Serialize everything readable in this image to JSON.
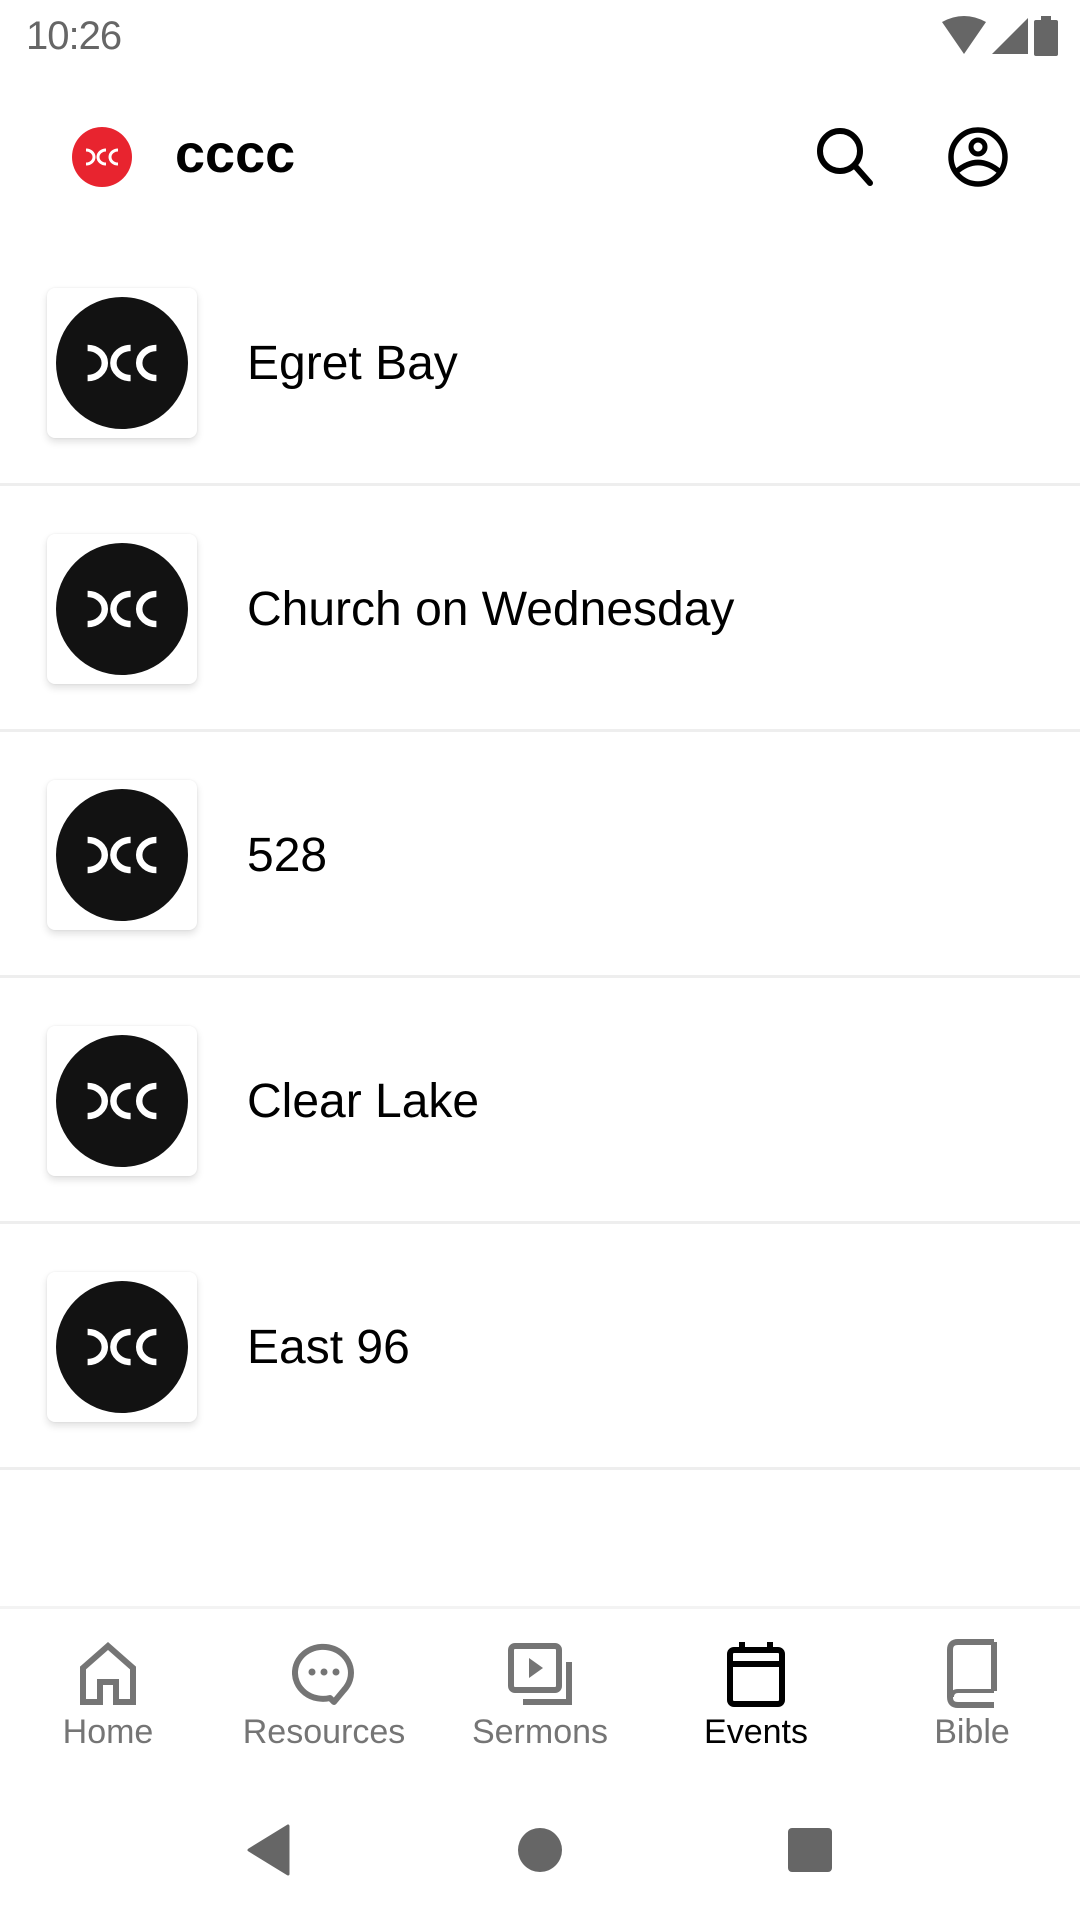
{
  "status_bar": {
    "time": "10:26",
    "icons": [
      "wifi-icon",
      "signal-icon",
      "battery-icon"
    ]
  },
  "app_bar": {
    "title": "cccc",
    "logo_color": "#e8242f",
    "actions": [
      {
        "name": "search",
        "icon": "search-icon"
      },
      {
        "name": "profile",
        "icon": "account-circle-icon"
      }
    ]
  },
  "list": {
    "items": [
      {
        "label": "Egret Bay"
      },
      {
        "label": "Church on Wednesday"
      },
      {
        "label": "528"
      },
      {
        "label": "Clear Lake"
      },
      {
        "label": "East 96"
      }
    ]
  },
  "bottom_nav": {
    "active": "Events",
    "tabs": [
      {
        "label": "Home",
        "icon": "home-icon"
      },
      {
        "label": "Resources",
        "icon": "chat-bubble-icon"
      },
      {
        "label": "Sermons",
        "icon": "video-library-icon"
      },
      {
        "label": "Events",
        "icon": "calendar-icon"
      },
      {
        "label": "Bible",
        "icon": "book-icon"
      }
    ]
  },
  "system_nav": {
    "buttons": [
      "back",
      "home",
      "recents"
    ]
  }
}
